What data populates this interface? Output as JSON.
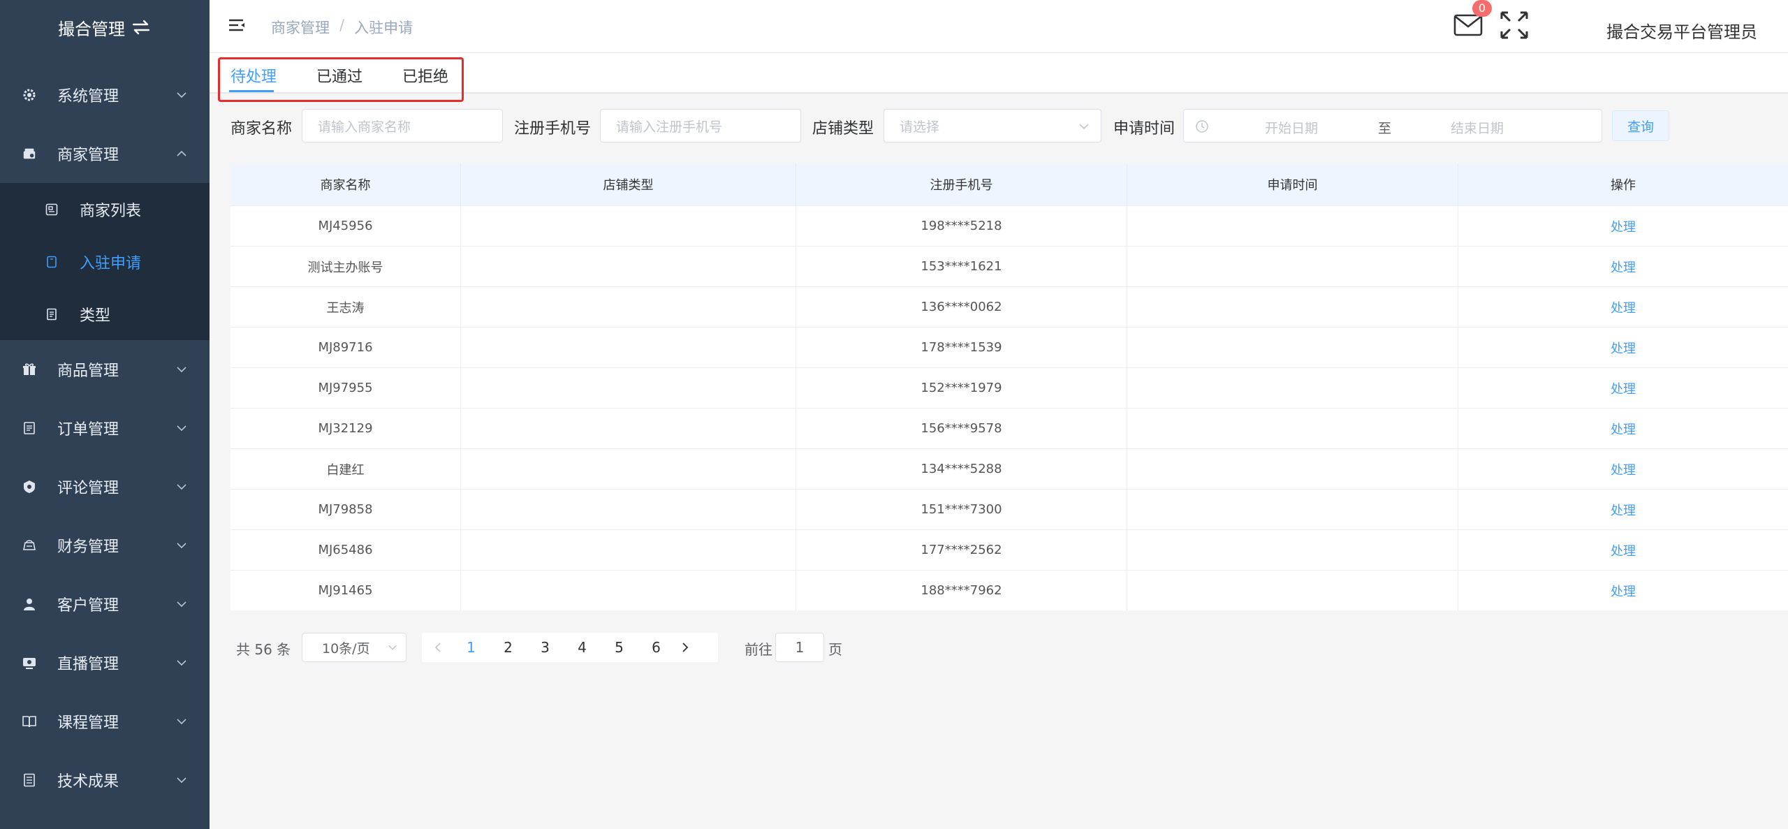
{
  "sidebar": {
    "brand": "撮合管理",
    "menu": [
      {
        "label": "系统管理",
        "icon": "gear-icon"
      },
      {
        "label": "商家管理",
        "icon": "store-icon",
        "expanded": true,
        "children": [
          {
            "label": "商家列表",
            "icon": "list-icon"
          },
          {
            "label": "入驻申请",
            "icon": "form-icon",
            "active": true
          },
          {
            "label": "类型",
            "icon": "doc-icon"
          }
        ]
      },
      {
        "label": "商品管理",
        "icon": "gift-icon"
      },
      {
        "label": "订单管理",
        "icon": "order-icon"
      },
      {
        "label": "评论管理",
        "icon": "comment-icon"
      },
      {
        "label": "财务管理",
        "icon": "finance-icon"
      },
      {
        "label": "客户管理",
        "icon": "user-icon"
      },
      {
        "label": "直播管理",
        "icon": "live-icon"
      },
      {
        "label": "课程管理",
        "icon": "book-icon"
      },
      {
        "label": "技术成果",
        "icon": "tech-icon"
      }
    ]
  },
  "header": {
    "breadcrumb": [
      "商家管理",
      "入驻申请"
    ],
    "breadcrumb_sep": "/",
    "mail_badge": "0",
    "username": "撮合交易平台管理员"
  },
  "tabs": [
    "待处理",
    "已通过",
    "已拒绝"
  ],
  "filters": {
    "merchant_label": "商家名称",
    "merchant_placeholder": "请输入商家名称",
    "phone_label": "注册手机号",
    "phone_placeholder": "请输入注册手机号",
    "shop_type_label": "店铺类型",
    "shop_type_placeholder": "请选择",
    "apply_time_label": "申请时间",
    "start_placeholder": "开始日期",
    "range_sep": "至",
    "end_placeholder": "结束日期",
    "search_button": "查询"
  },
  "table": {
    "columns": [
      "商家名称",
      "店铺类型",
      "注册手机号",
      "申请时间",
      "操作"
    ],
    "action_label": "处理",
    "rows": [
      {
        "name": "MJ45956",
        "shop_type": "",
        "phone": "198****5218",
        "time": ""
      },
      {
        "name": "测试主办账号",
        "shop_type": "",
        "phone": "153****1621",
        "time": ""
      },
      {
        "name": "王志涛",
        "shop_type": "",
        "phone": "136****0062",
        "time": ""
      },
      {
        "name": "MJ89716",
        "shop_type": "",
        "phone": "178****1539",
        "time": ""
      },
      {
        "name": "MJ97955",
        "shop_type": "",
        "phone": "152****1979",
        "time": ""
      },
      {
        "name": "MJ32129",
        "shop_type": "",
        "phone": "156****9578",
        "time": ""
      },
      {
        "name": "白建红",
        "shop_type": "",
        "phone": "134****5288",
        "time": ""
      },
      {
        "name": "MJ79858",
        "shop_type": "",
        "phone": "151****7300",
        "time": ""
      },
      {
        "name": "MJ65486",
        "shop_type": "",
        "phone": "177****2562",
        "time": ""
      },
      {
        "name": "MJ91465",
        "shop_type": "",
        "phone": "188****7962",
        "time": ""
      }
    ]
  },
  "pagination": {
    "total": "共 56 条",
    "page_size": "10条/页",
    "pages": [
      "1",
      "2",
      "3",
      "4",
      "5",
      "6"
    ],
    "current": "1",
    "goto_label": "前往",
    "goto_value": "1",
    "goto_suffix": "页"
  },
  "colors": {
    "sidebar_bg": "#304156",
    "submenu_bg": "#1f2d3d",
    "accent": "#409eff",
    "badge": "#f56c6c",
    "highlight_border": "#e82c2c"
  }
}
